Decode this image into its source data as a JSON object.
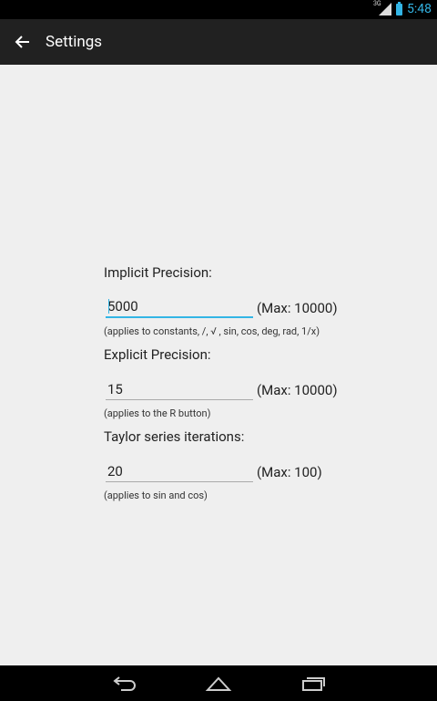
{
  "status_bar": {
    "time": "5:48",
    "network": "3G"
  },
  "action_bar": {
    "title": "Settings"
  },
  "settings": {
    "implicit": {
      "label": "Implicit Precision:",
      "value": "5000",
      "max": "(Max: 10000)",
      "hint": "(applies to constants, /, √ , sin, cos, deg, rad, 1/x)"
    },
    "explicit": {
      "label": "Explicit Precision:",
      "value": "15",
      "max": "(Max: 10000)",
      "hint": "(applies to the R button)"
    },
    "taylor": {
      "label": "Taylor series iterations:",
      "value": "20",
      "max": "(Max: 100)",
      "hint": "(applies to sin and cos)"
    }
  },
  "colors": {
    "accent": "#33b5e5",
    "action_bar": "#212121",
    "background": "#efefef"
  }
}
